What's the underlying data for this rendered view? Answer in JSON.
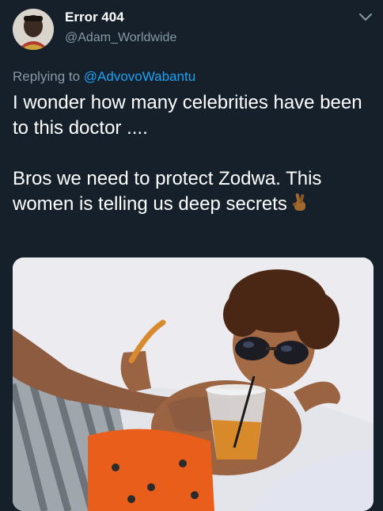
{
  "tweet": {
    "author_name": "Error 404",
    "author_handle": "@Adam_Worldwide",
    "replying_prefix": "Replying to",
    "replying_to": "@AdvovoWabantu",
    "text_line1": "I wonder how many celebrities have been to this doctor ....",
    "text_line2": "Bros we need to protect Zodwa. This women is telling us deep secrets",
    "emoji_icon": "crossed-fingers-icon",
    "menu_icon": "chevron-down-icon"
  },
  "colors": {
    "background": "#15202b",
    "text_primary": "#ffffff",
    "text_secondary": "#8899a6",
    "link": "#1da1f2"
  }
}
